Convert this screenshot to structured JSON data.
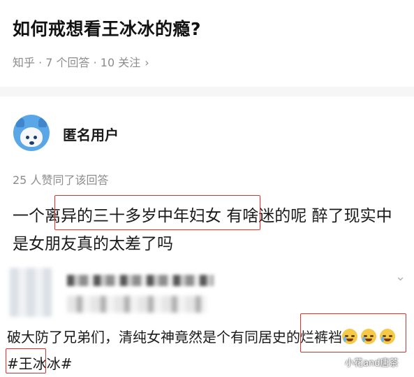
{
  "question": {
    "title": "如何戒想看王冰冰的瘾?",
    "meta": "知乎 · 7 个回答 · 10 关注",
    "meta_chevron": "›"
  },
  "answer": {
    "author": "匿名用户",
    "avatar_icon": "anonymous-bear-avatar",
    "upvote_text": "25 人赞同了该回答",
    "text": "一个离异的三十多岁中年妇女 有啥迷的呢 醉了现实中是女朋友真的太差了吗"
  },
  "comment": {
    "text": "破大防了兄弟们，清纯女神竟然是个有同居史的烂裤裆",
    "hashtag": "#王冰冰#",
    "emoji_count": 3,
    "collapse_icon": "chevron-down-icon"
  },
  "watermark": "小花and唐茶",
  "colors": {
    "highlight_box": "#e0312c",
    "meta_gray": "#8c8c8c",
    "avatar_blue": "#5aa7e8"
  }
}
